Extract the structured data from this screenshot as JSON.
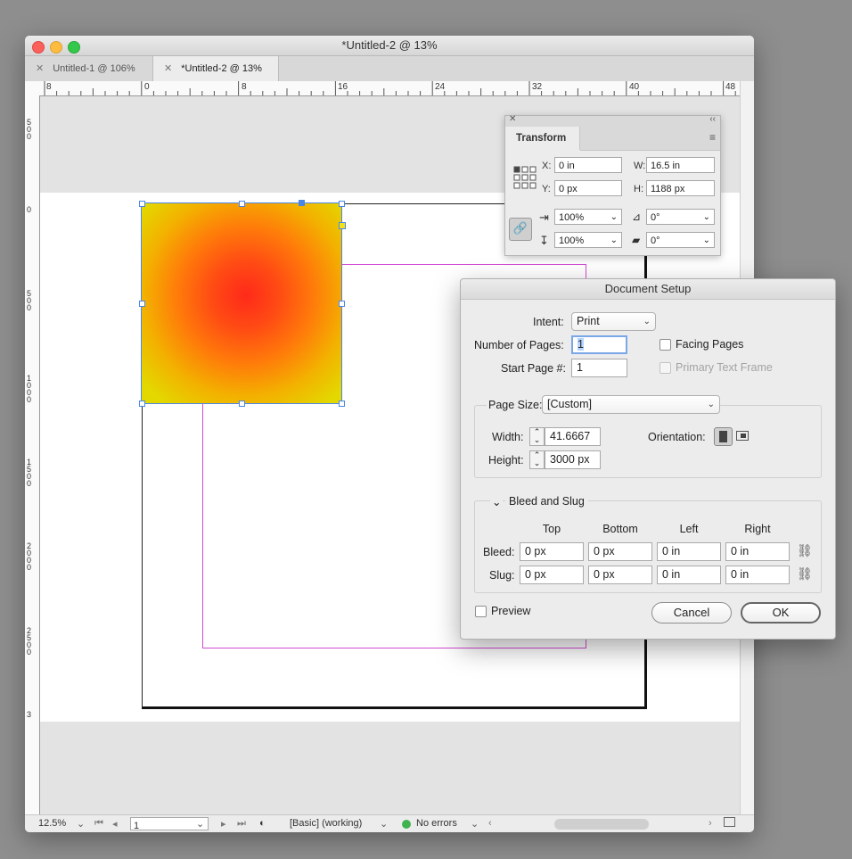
{
  "window": {
    "title": "*Untitled-2 @ 13%"
  },
  "tabs": [
    {
      "label": "Untitled-1 @ 106%"
    },
    {
      "label": "*Untitled-2 @ 13%"
    }
  ],
  "ruler": {
    "top": [
      "8",
      "0",
      "8",
      "16",
      "24",
      "32",
      "40",
      "48"
    ],
    "left": [
      "500",
      "0",
      "500",
      "1000",
      "1500",
      "2000",
      "2500",
      "3"
    ]
  },
  "transform_panel": {
    "title": "Transform",
    "x_label": "X:",
    "x_value": "0 in",
    "y_label": "Y:",
    "y_value": "0 px",
    "w_label": "W:",
    "w_value": "16.5 in",
    "h_label": "H:",
    "h_value": "1188 px",
    "scale_x": "100%",
    "scale_y": "100%",
    "rotate": "0°",
    "shear": "0°"
  },
  "document_setup": {
    "title": "Document Setup",
    "intent_label": "Intent:",
    "intent_value": "Print",
    "pages_label": "Number of Pages:",
    "pages_value": "1",
    "start_label": "Start Page #:",
    "start_value": "1",
    "facing_pages": "Facing Pages",
    "primary_text_frame": "Primary Text Frame",
    "page_size_label": "Page Size:",
    "page_size_value": "[Custom]",
    "width_label": "Width:",
    "width_value": "41.6667",
    "height_label": "Height:",
    "height_value": "3000 px",
    "orientation_label": "Orientation:",
    "bleed_slug_title": "Bleed and Slug",
    "columns": [
      "Top",
      "Bottom",
      "Left",
      "Right"
    ],
    "bleed_label": "Bleed:",
    "bleed_values": [
      "0 px",
      "0 px",
      "0 in",
      "0 in"
    ],
    "slug_label": "Slug:",
    "slug_values": [
      "0 px",
      "0 px",
      "0 in",
      "0 in"
    ],
    "preview_label": "Preview",
    "cancel_label": "Cancel",
    "ok_label": "OK"
  },
  "status": {
    "zoom": "12.5%",
    "page": "1",
    "profile": "[Basic] (working)",
    "preflight": "No errors"
  },
  "colors": {
    "accent": "#4a86e8",
    "margin_guide": "#d24bd2",
    "gradient_center": "#ff2a1a",
    "gradient_edge": "#e3d800",
    "preflight_ok": "#3fb34f"
  }
}
